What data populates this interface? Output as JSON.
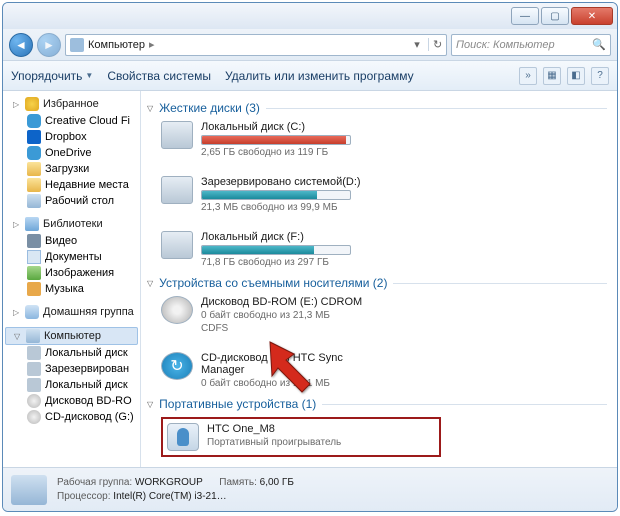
{
  "titlebar": {
    "icon": "computer-icon"
  },
  "address": {
    "crumb1": "Компьютер",
    "separator": "▸",
    "search_placeholder": "Поиск: Компьютер"
  },
  "toolbar": {
    "organize": "Упорядочить",
    "sysprops": "Свойства системы",
    "uninstall": "Удалить или изменить программу"
  },
  "sidebar": {
    "favorites": {
      "label": "Избранное",
      "items": [
        {
          "label": "Creative Cloud Fi",
          "icon": "i-cloud"
        },
        {
          "label": "Dropbox",
          "icon": "i-drop"
        },
        {
          "label": "OneDrive",
          "icon": "i-cloud"
        },
        {
          "label": "Загрузки",
          "icon": "i-folder"
        },
        {
          "label": "Недавние места",
          "icon": "i-folder"
        },
        {
          "label": "Рабочий стол",
          "icon": "i-comp"
        }
      ]
    },
    "libraries": {
      "label": "Библиотеки",
      "items": [
        {
          "label": "Видео",
          "icon": "i-film"
        },
        {
          "label": "Документы",
          "icon": "i-doc"
        },
        {
          "label": "Изображения",
          "icon": "i-img"
        },
        {
          "label": "Музыка",
          "icon": "i-music"
        }
      ]
    },
    "homegroup": {
      "label": "Домашняя группа"
    },
    "computer": {
      "label": "Компьютер",
      "items": [
        {
          "label": "Локальный диск",
          "icon": "i-drive"
        },
        {
          "label": "Зарезервирован",
          "icon": "i-drive"
        },
        {
          "label": "Локальный диск",
          "icon": "i-drive"
        },
        {
          "label": "Дисковод BD-RO",
          "icon": "i-disc"
        },
        {
          "label": "CD-дисковод (G:)",
          "icon": "i-disc"
        }
      ]
    }
  },
  "content": {
    "hdd": {
      "title": "Жесткие диски (3)",
      "drives": [
        {
          "name": "Локальный диск (C:)",
          "status": "2,65 ГБ свободно из 119 ГБ",
          "fill": 97,
          "color": "red"
        },
        {
          "name": "Зарезервировано системой(D:)",
          "status": "21,3 МБ свободно из 99,9 МБ",
          "fill": 78,
          "color": "teal"
        },
        {
          "name": "Локальный диск (F:)",
          "status": "71,8 ГБ свободно из 297 ГБ",
          "fill": 76,
          "color": "teal"
        }
      ]
    },
    "removable": {
      "title": "Устройства со съемными носителями (2)",
      "drives": [
        {
          "name": "Дисковод BD-ROM (E:) CDROM",
          "status": "0 байт свободно из 21,3 МБ",
          "sub2": "CDFS"
        },
        {
          "name": "CD-дисковод (G:) HTC Sync Manager",
          "status": "0 байт свободно из 17,1 МБ"
        }
      ]
    },
    "portable": {
      "title": "Портативные устройства (1)",
      "device": {
        "name": "HTC One_M8",
        "type": "Портативный проигрыватель"
      }
    }
  },
  "statusbar": {
    "workgroup_label": "Рабочая группа:",
    "workgroup_value": "WORKGROUP",
    "cpu_label": "Процессор:",
    "cpu_value": "Intel(R) Core(TM) i3-21…",
    "mem_label": "Память:",
    "mem_value": "6,00 ГБ"
  }
}
